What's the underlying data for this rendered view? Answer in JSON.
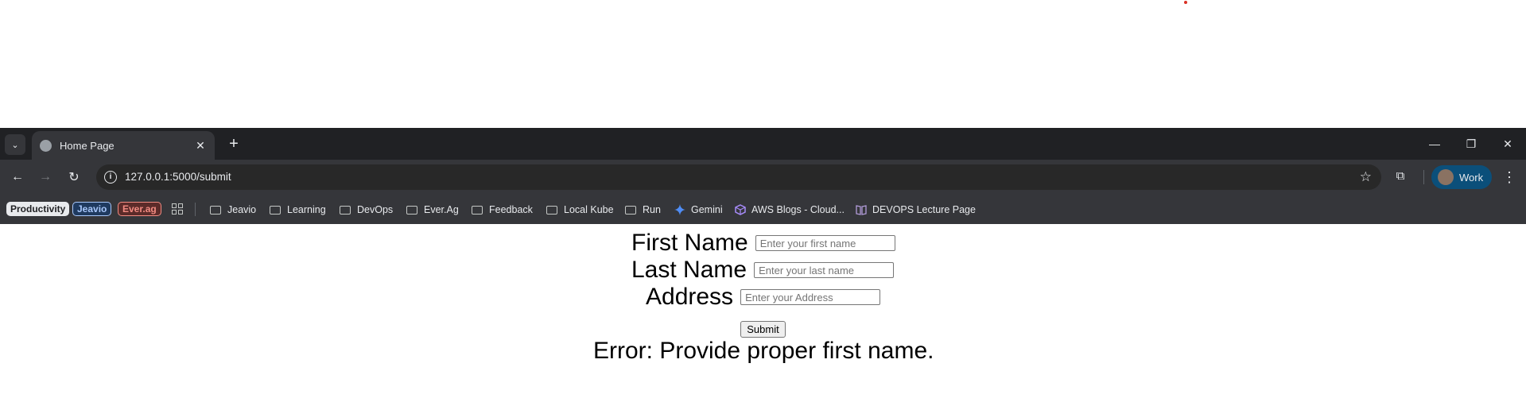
{
  "browser": {
    "tab": {
      "title": "Home Page",
      "close_glyph": "✕"
    },
    "tab_search_glyph": "⌄",
    "new_tab_glyph": "+",
    "window_controls": {
      "minimize": "—",
      "restore": "❐",
      "close": "✕"
    },
    "nav": {
      "back": "←",
      "forward": "→",
      "reload": "↻"
    },
    "address": {
      "url": "127.0.0.1:5000/submit",
      "info_glyph": "i",
      "star_glyph": "☆"
    },
    "extensions_glyph": "⧉",
    "profile": {
      "label": "Work"
    },
    "menu_glyph": "⋮",
    "bookmarks": {
      "chips": [
        {
          "label": "Productivity",
          "bg": "#e8eaed",
          "fg": "#202124",
          "border": "#e8eaed"
        },
        {
          "label": "Jeavio",
          "bg": "#1f3a5f",
          "fg": "#a8c7fa",
          "border": "#a8c7fa"
        },
        {
          "label": "Ever.ag",
          "bg": "#5c2b29",
          "fg": "#f28b82",
          "border": "#f28b82"
        }
      ],
      "folders": [
        "Jeavio",
        "Learning",
        "DevOps",
        "Ever.Ag",
        "Feedback",
        "Local Kube",
        "Run"
      ],
      "links": [
        {
          "label": "Gemini",
          "icon": "gemini-icon"
        },
        {
          "label": "AWS Blogs - Cloud...",
          "icon": "cube-icon"
        },
        {
          "label": "DEVOPS Lecture Page",
          "icon": "book-icon"
        }
      ]
    }
  },
  "form": {
    "first_name": {
      "label": "First Name",
      "placeholder": "Enter your first name",
      "value": ""
    },
    "last_name": {
      "label": "Last Name",
      "placeholder": "Enter your last name",
      "value": ""
    },
    "address": {
      "label": "Address",
      "placeholder": "Enter your Address",
      "value": ""
    },
    "submit_label": "Submit",
    "error": "Error: Provide proper first name."
  }
}
